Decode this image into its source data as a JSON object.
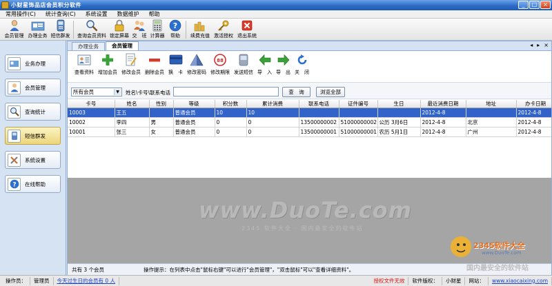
{
  "window": {
    "title": "小财星饰品店会员积分软件",
    "min": "_",
    "max": "□",
    "close": "×"
  },
  "menu": [
    "常用操作(C)",
    "统计查询(C)",
    "系统设置",
    "数据维护",
    "帮助"
  ],
  "toolbar": [
    {
      "label": "会员管理",
      "icon": "user-icon"
    },
    {
      "label": "办理业务",
      "icon": "business-icon"
    },
    {
      "label": "短信群发",
      "icon": "phone-icon"
    },
    {
      "label": "查询会员资料",
      "icon": "magnifier-icon"
    },
    {
      "label": "锁定屏幕",
      "icon": "lock-icon"
    },
    {
      "label": "交　班",
      "icon": "handover-icon"
    },
    {
      "label": "计算器",
      "icon": "calculator-icon"
    },
    {
      "label": "帮助",
      "icon": "help-icon"
    },
    {
      "label": "续费充值",
      "icon": "coins-icon"
    },
    {
      "label": "激活授权",
      "icon": "key-icon"
    },
    {
      "label": "退出系统",
      "icon": "exit-icon"
    }
  ],
  "sidebar": [
    {
      "label": "业务办理",
      "icon": "business-icon",
      "active": false
    },
    {
      "label": "会员管理",
      "icon": "user-icon",
      "active": false
    },
    {
      "label": "查询统计",
      "icon": "magnifier-icon",
      "active": false
    },
    {
      "label": "短信群发",
      "icon": "phone-icon",
      "active": true
    },
    {
      "label": "系统设置",
      "icon": "tools-icon",
      "active": false
    },
    {
      "label": "在线帮助",
      "icon": "help-icon",
      "active": false
    }
  ],
  "tabs": [
    {
      "label": "办理业务",
      "active": false
    },
    {
      "label": "会员管理",
      "active": true
    }
  ],
  "tabctl": {
    "prev": "◂",
    "next": "▸",
    "close": "×"
  },
  "actions": [
    {
      "label": "查看资料",
      "icon": "profile-card-icon"
    },
    {
      "label": "增加会员",
      "icon": "plus-icon"
    },
    {
      "label": "修改会员",
      "icon": "edit-document-icon"
    },
    {
      "label": "删除会员",
      "icon": "minus-icon"
    },
    {
      "label": "换　卡",
      "icon": "card-icon"
    },
    {
      "label": "修改密码",
      "icon": "pyramid-icon"
    },
    {
      "label": "修改期限",
      "icon": "deadline-badge-icon"
    },
    {
      "label": "发送短信",
      "icon": "sms-icon"
    },
    {
      "label": "导　入",
      "icon": "import-arrow-icon"
    },
    {
      "label": "导　出",
      "icon": "export-arrow-icon"
    },
    {
      "label": "关　闭",
      "icon": "close-refresh-icon"
    }
  ],
  "search": {
    "select_value": "所有会员",
    "label": "姓名\\卡号\\联系电话",
    "input_value": "",
    "query_button": "查　询",
    "browse_button": "浏览全部"
  },
  "table": {
    "columns": [
      "卡号",
      "姓名",
      "性别",
      "等级",
      "积分数",
      "累计消费",
      "联系电话",
      "证件编号",
      "生日",
      "最近消费日期",
      "地址",
      "办卡日期"
    ],
    "rows": [
      [
        "10003",
        "王五",
        "",
        "普通会员",
        "10",
        "10",
        "",
        "",
        "",
        "2012-4-8",
        "",
        "2012-4-8"
      ],
      [
        "10002",
        "李四",
        "男",
        "普通会员",
        "0",
        "0",
        "13500000002",
        "51000000002",
        "公历 3月6日",
        "2012-4-8",
        "北京",
        "2012-4-8"
      ],
      [
        "10001",
        "张三",
        "女",
        "普通会员",
        "0",
        "0",
        "13500000001",
        "51000000001",
        "农历 5月1日",
        "2012-4-8",
        "广州",
        "2012-4-8"
      ]
    ],
    "selected_row": 0
  },
  "watermark": {
    "main": "www.DuoTe.com",
    "sub": "2345 软件大全 · 国内最安全的软件站"
  },
  "footer": {
    "count": "共有 3 个会员",
    "tip": "操作提示：在列表中点击\"鼠标右键\"可以进行\"会员管理\"，\"双击鼠标\"可以\"查看详细资料\"。"
  },
  "status": {
    "operator_label": "操作员：",
    "operator": "管理员",
    "birthday_link": "今天过生日的会员有 0 人",
    "license": "授权文件无效",
    "copyright_label": "软件版权：",
    "copyright": "小财星",
    "website_label": "网站：",
    "website": "www.xiaocaixing.com"
  },
  "corner_logo": {
    "title": "2345软件大全",
    "url": "www.DuoTe.com",
    "slogan": "国内最安全的软件站"
  }
}
